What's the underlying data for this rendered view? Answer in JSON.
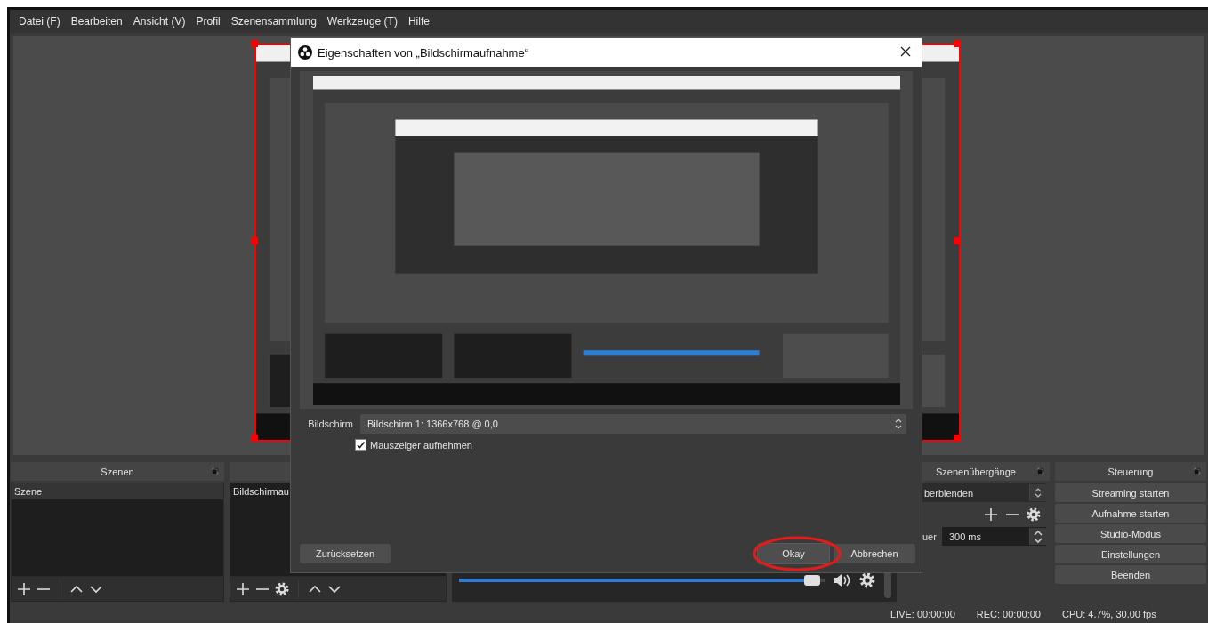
{
  "menu": [
    {
      "label": "Datei (F)"
    },
    {
      "label": "Bearbeiten"
    },
    {
      "label": "Ansicht (V)"
    },
    {
      "label": "Profil"
    },
    {
      "label": "Szenensammlung"
    },
    {
      "label": "Werkzeuge (T)"
    },
    {
      "label": "Hilfe"
    }
  ],
  "preview": {
    "kind": "picture",
    "selected": true
  },
  "dialog": {
    "title": "Eigenschaften von „Bildschirmaufnahme“",
    "preview": {
      "kind": "picture"
    },
    "field": {
      "label": "Bildschirm",
      "value": "Bildschirm 1: 1366x768 @ 0,0"
    },
    "checkbox": {
      "label": "Mauszeiger aufnehmen",
      "checked": true
    },
    "buttons": [
      {
        "label": "Zurücksetzen",
        "highlighted": false
      },
      {
        "label": "Okay",
        "highlighted": true
      },
      {
        "label": "Abbrechen",
        "highlighted": false
      }
    ]
  },
  "scenes": {
    "title": "Szenen",
    "items": [
      {
        "label": "Szene",
        "selected": true
      }
    ]
  },
  "sources": {
    "items": [
      {
        "label": "Bildschirmau",
        "selected": false
      }
    ]
  },
  "mixer": {
    "channels": [
      {
        "level": 0.98
      }
    ]
  },
  "transitions": {
    "title": "Szenenübergänge",
    "transition": "berblenden",
    "duration_label": "uer",
    "duration": "300 ms"
  },
  "controls": {
    "title": "Steuerung",
    "buttons": [
      {
        "label": "Streaming starten"
      },
      {
        "label": "Aufnahme starten"
      },
      {
        "label": "Studio-Modus"
      },
      {
        "label": "Einstellungen"
      },
      {
        "label": "Beenden"
      }
    ]
  },
  "status_bar": [
    "LIVE: 00:00:00",
    "REC: 00:00:00",
    "CPU: 4.7%, 30.00 fps"
  ]
}
